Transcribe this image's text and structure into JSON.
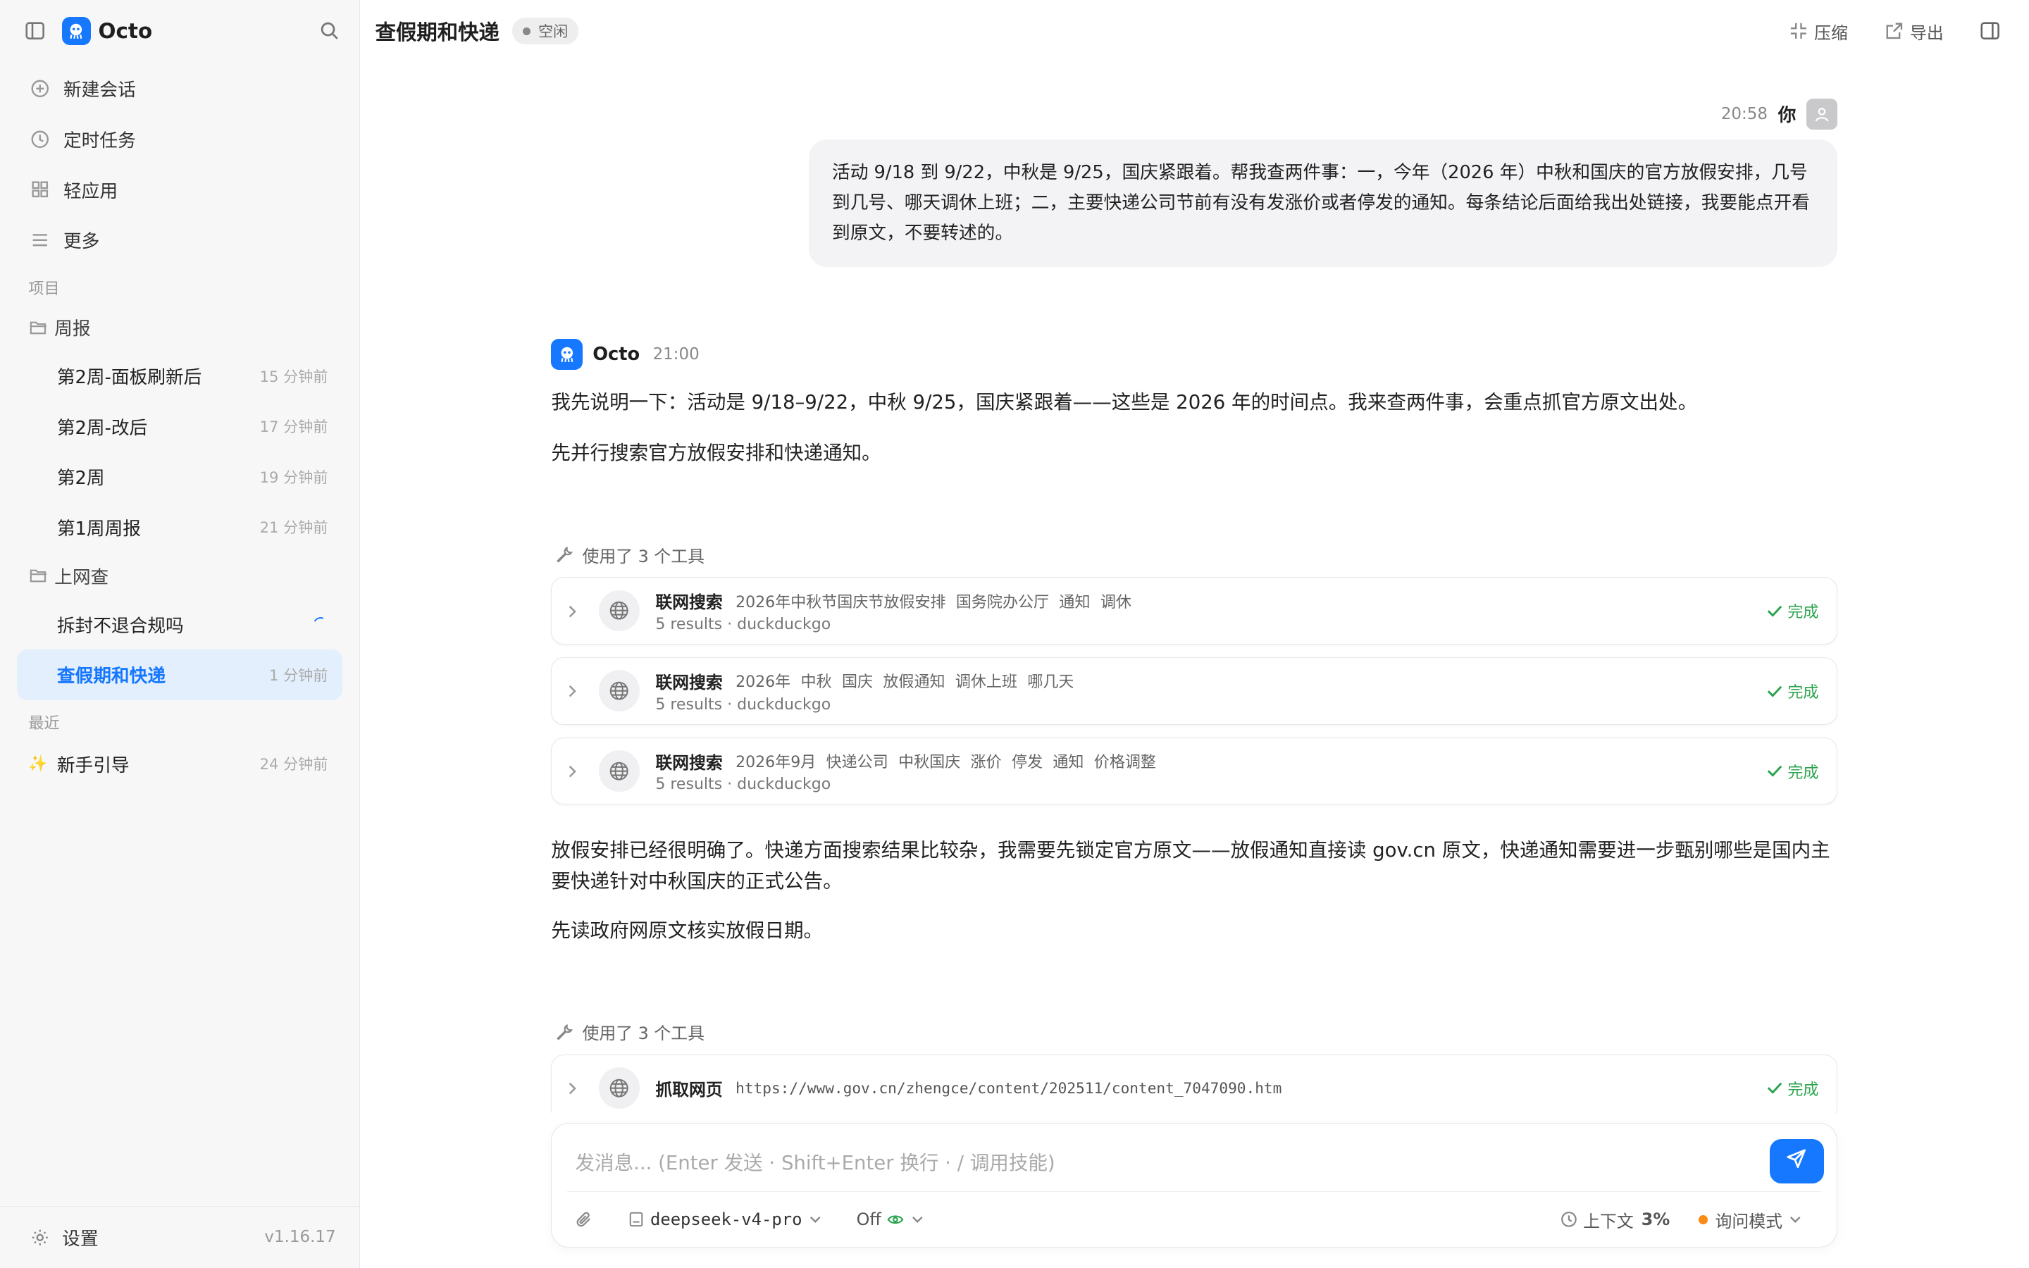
{
  "app": {
    "name": "Octo",
    "version": "v1.16.17"
  },
  "sidebar": {
    "nav": [
      {
        "label": "新建会话",
        "icon": "plus-circle-icon"
      },
      {
        "label": "定时任务",
        "icon": "clock-icon"
      },
      {
        "label": "轻应用",
        "icon": "grid-icon"
      },
      {
        "label": "更多",
        "icon": "menu-icon"
      }
    ],
    "projects_label": "项目",
    "folders": [
      {
        "name": "周报",
        "items": [
          {
            "title": "第2周-面板刷新后",
            "time": "15 分钟前"
          },
          {
            "title": "第2周-改后",
            "time": "17 分钟前"
          },
          {
            "title": "第2周",
            "time": "19 分钟前"
          },
          {
            "title": "第1周周报",
            "time": "21 分钟前"
          }
        ]
      },
      {
        "name": "上网查",
        "items": [
          {
            "title": "拆封不退合规吗",
            "time": ""
          },
          {
            "title": "查假期和快递",
            "time": "1 分钟前"
          }
        ]
      }
    ],
    "recent_label": "最近",
    "recent": [
      {
        "emoji": "✨",
        "title": "新手引导",
        "time": "24 分钟前"
      }
    ],
    "settings_label": "设置"
  },
  "header": {
    "title": "查假期和快递",
    "status": "空闲",
    "compress_label": "压缩",
    "export_label": "导出"
  },
  "conversation": {
    "user": {
      "time": "20:58",
      "name": "你",
      "text": "活动 9/18 到 9/22，中秋是 9/25，国庆紧跟着。帮我查两件事：一，今年（2026 年）中秋和国庆的官方放假安排，几号到几号、哪天调休上班；二，主要快递公司节前有没有发涨价或者停发的通知。每条结论后面给我出处链接，我要能点开看到原文，不要转述的。"
    },
    "assistant": {
      "name": "Octo",
      "time": "21:00",
      "p1": "我先说明一下：活动是 9/18–9/22，中秋 9/25，国庆紧跟着——这些是 2026 年的时间点。我来查两件事，会重点抓官方原文出处。",
      "p2": "先并行搜索官方放假安排和快递通知。",
      "tools1_label": "使用了 3 个工具",
      "tools1": [
        {
          "name": "联网搜索",
          "query": "2026年中秋节国庆节放假安排 国务院办公厅 通知 调休",
          "meta": "5 results · duckduckgo",
          "status": "完成"
        },
        {
          "name": "联网搜索",
          "query": "2026年 中秋 国庆 放假通知 调休上班 哪几天",
          "meta": "5 results · duckduckgo",
          "status": "完成"
        },
        {
          "name": "联网搜索",
          "query": "2026年9月 快递公司 中秋国庆 涨价 停发 通知 价格调整",
          "meta": "5 results · duckduckgo",
          "status": "完成"
        }
      ],
      "p3": "放假安排已经很明确了。快递方面搜索结果比较杂，我需要先锁定官方原文——放假通知直接读 gov.cn 原文，快递通知需要进一步甄别哪些是国内主要快递针对中秋国庆的正式公告。",
      "p4": "先读政府网原文核实放假日期。",
      "tools2_label": "使用了 3 个工具",
      "tools2": [
        {
          "name": "抓取网页",
          "url": "https://www.gov.cn/zhengce/content/202511/content_7047090.htm",
          "status": "完成"
        }
      ]
    }
  },
  "composer": {
    "placeholder": "发消息... (Enter 发送 · Shift+Enter 换行 · / 调用技能)",
    "model": "deepseek-v4-pro",
    "thinking": "Off",
    "context_label": "上下文",
    "context_value": "3%",
    "mode": "询问模式"
  },
  "colors": {
    "accent": "#1677ff",
    "success": "#2ba44e",
    "mode_dot": "#fa8c16"
  }
}
